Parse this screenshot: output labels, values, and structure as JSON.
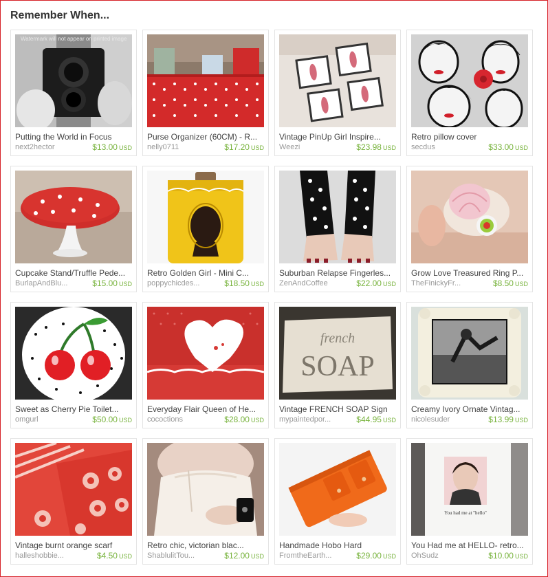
{
  "page": {
    "title": "Remember When..."
  },
  "watermark": "Watermark will not appear on printed image",
  "items": [
    {
      "title": "Putting the World in Focus",
      "shop": "next2hector",
      "price": "$13.00",
      "currency": "USD",
      "image": "vintage-camera-photo"
    },
    {
      "title": "Purse Organizer (60CM) - R...",
      "shop": "nelly0711",
      "price": "$17.20",
      "currency": "USD",
      "image": "red-polka-dot-organizer-photo"
    },
    {
      "title": "Vintage PinUp Girl Inspire...",
      "shop": "Weezi",
      "price": "$23.98",
      "currency": "USD",
      "image": "pinup-coasters-photo"
    },
    {
      "title": "Retro pillow cover",
      "shop": "secdus",
      "price": "$33.00",
      "currency": "USD",
      "image": "retro-faces-pillow-photo"
    },
    {
      "title": "Cupcake Stand/Truffle Pede...",
      "shop": "BurlapAndBlu...",
      "price": "$15.00",
      "currency": "USD",
      "image": "red-dot-cake-stand-photo"
    },
    {
      "title": "Retro Golden Girl - Mini C...",
      "shop": "poppychicdes...",
      "price": "$18.50",
      "currency": "USD",
      "image": "yellow-silhouette-flask-photo"
    },
    {
      "title": "Suburban Relapse Fingerles...",
      "shop": "ZenAndCoffee",
      "price": "$22.00",
      "currency": "USD",
      "image": "polka-dot-gloves-photo"
    },
    {
      "title": "Grow Love Treasured Ring P...",
      "shop": "TheFinickyFr...",
      "price": "$8.50",
      "currency": "USD",
      "image": "pincushion-ring-photo"
    },
    {
      "title": "Sweet as Cherry Pie Toilet...",
      "shop": "omgurl",
      "price": "$50.00",
      "currency": "USD",
      "image": "cherry-toilet-seat-photo"
    },
    {
      "title": "Everyday Flair Queen of He...",
      "shop": "cococtions",
      "price": "$28.00",
      "currency": "USD",
      "image": "heart-dish-apron-photo"
    },
    {
      "title": "Vintage FRENCH SOAP Sign",
      "shop": "mypaintedpor...",
      "price": "$44.95",
      "currency": "USD",
      "image": "french-soap-sign-photo",
      "sign_line1": "french",
      "sign_line2": "SOAP"
    },
    {
      "title": "Creamy Ivory Ornate Vintag...",
      "shop": "nicolesuder",
      "price": "$13.99",
      "currency": "USD",
      "image": "ornate-frame-photo"
    },
    {
      "title": "Vintage burnt orange scarf",
      "shop": "halleshobbie...",
      "price": "$4.50",
      "currency": "USD",
      "image": "red-pattern-scarf-photo"
    },
    {
      "title": "Retro chic, victorian blac...",
      "shop": "ShablulitTou...",
      "price": "$12.00",
      "currency": "USD",
      "image": "lace-cuff-photo"
    },
    {
      "title": "Handmade Hobo Hard",
      "shop": "FromtheEarth...",
      "price": "$29.00",
      "currency": "USD",
      "image": "orange-wallet-photo"
    },
    {
      "title": "You Had me at HELLO- retro...",
      "shop": "OhSudz",
      "price": "$10.00",
      "currency": "USD",
      "image": "hello-towel-photo",
      "towel_text": "You had me at \"hello\""
    }
  ]
}
